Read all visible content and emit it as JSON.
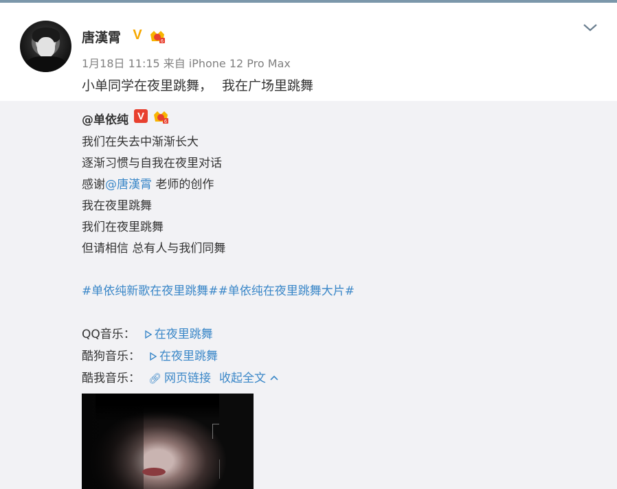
{
  "post": {
    "author": "唐漢霄",
    "date": "1月18日 11:15",
    "source_prefix": "来自",
    "source_device": "iPhone 12 Pro Max",
    "text_part1": "小单同学在夜里跳舞，",
    "text_part2": "我在广场里跳舞"
  },
  "repost": {
    "author": "@单依纯",
    "verified_label": "V",
    "lines": [
      "我们在失去中渐渐长大",
      "逐渐习惯与自我在夜里对话"
    ],
    "thanks_prefix": "感谢",
    "thanks_mention": "@唐漢霄",
    "thanks_suffix": " 老师的创作",
    "line4": "我在夜里跳舞",
    "line5": "我们在夜里跳舞",
    "line6": "但请相信 总有人与我们同舞",
    "hashtags": "#单依纯新歌在夜里跳舞##单依纯在夜里跳舞大片#",
    "qq_label": "QQ音乐：",
    "qq_link": "在夜里跳舞",
    "kugou_label": "酷狗音乐：",
    "kugou_link": "在夜里跳舞",
    "kuwo_label": "酷我音乐：",
    "kuwo_link": "网页链接",
    "collapse_label": "收起全文"
  },
  "colors": {
    "link": "#3a87c8",
    "gold_v": "#f6a800",
    "red_v": "#e8402f"
  },
  "icons": [
    "chevron-down-icon",
    "verified-v-icon",
    "vip-crown-icon",
    "play-icon",
    "link-icon",
    "chevron-up-icon"
  ]
}
